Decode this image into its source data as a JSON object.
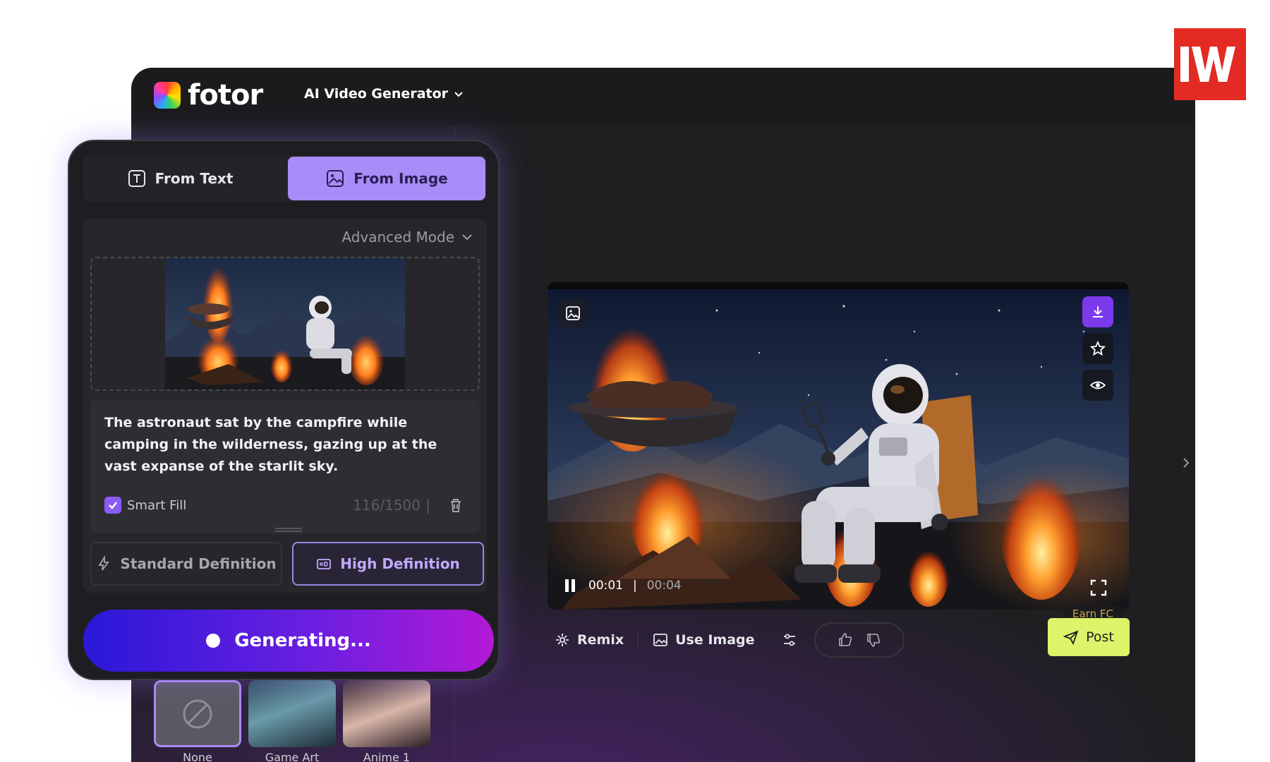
{
  "header": {
    "logo_text": "fotor",
    "product_menu": "AI Video Generator"
  },
  "panel": {
    "tabs": [
      {
        "label": "From Text",
        "active": false
      },
      {
        "label": "From Image",
        "active": true
      }
    ],
    "advanced_mode": "Advanced Mode",
    "prompt": "The astronaut sat by the campfire while camping in the wilderness, gazing up at the vast expanse of the starlit sky.",
    "smart_fill": {
      "label": "Smart Fill",
      "checked": true
    },
    "char_count": "116/1500",
    "definitions": [
      {
        "label": "Standard Definition",
        "selected": false
      },
      {
        "label": "High Definition",
        "selected": true
      }
    ],
    "generate_label": "Generating..."
  },
  "styles": [
    {
      "label": "None"
    },
    {
      "label": "Game Art"
    },
    {
      "label": "Anime 1"
    }
  ],
  "player": {
    "current_time": "00:01",
    "separator": "|",
    "total_time": "00:04"
  },
  "actions": {
    "remix": "Remix",
    "use_image": "Use Image",
    "earn": "Earn FC",
    "post": "Post"
  },
  "colors": {
    "accent": "#a98cf7",
    "download": "#7c3aed",
    "post_bg": "#dcf36a",
    "watermark": "#e32b24"
  }
}
